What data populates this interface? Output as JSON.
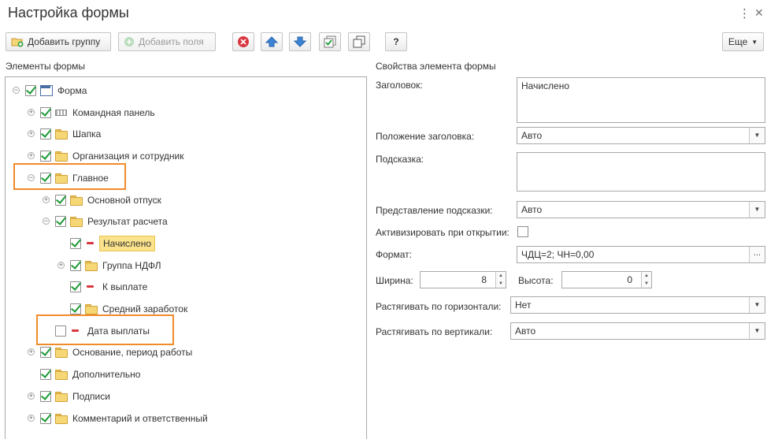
{
  "window": {
    "title": "Настройка формы"
  },
  "toolbar": {
    "add_group_label": "Добавить группу",
    "add_fields_label": "Добавить поля",
    "help_label": "?",
    "more_label": "Еще"
  },
  "colors": {
    "accent_highlight": "#f08b2a",
    "selection": "#fbe38b",
    "check": "#1d9b37"
  },
  "left": {
    "title": "Элементы формы",
    "tree": [
      {
        "label": "Форма",
        "level": 0,
        "expander": "minus",
        "checked": true,
        "icon": "form-icon"
      },
      {
        "label": "Командная панель",
        "level": 1,
        "expander": "plus",
        "checked": true,
        "icon": "command-panel-icon"
      },
      {
        "label": "Шапка",
        "level": 1,
        "expander": "plus",
        "checked": true,
        "icon": "folder-icon"
      },
      {
        "label": "Организация и сотрудник",
        "level": 1,
        "expander": "plus",
        "checked": true,
        "icon": "folder-icon"
      },
      {
        "label": "Главное",
        "level": 1,
        "expander": "minus",
        "checked": true,
        "icon": "folder-icon"
      },
      {
        "label": "Основной отпуск",
        "level": 2,
        "expander": "plus",
        "checked": true,
        "icon": "folder-icon"
      },
      {
        "label": "Результат расчета",
        "level": 2,
        "expander": "minus",
        "checked": true,
        "icon": "folder-icon"
      },
      {
        "label": "Начислено",
        "level": 3,
        "expander": "",
        "checked": true,
        "icon": "field-icon",
        "selected": true
      },
      {
        "label": "Группа НДФЛ",
        "level": 3,
        "expander": "plus",
        "checked": true,
        "icon": "folder-icon"
      },
      {
        "label": "К выплате",
        "level": 3,
        "expander": "",
        "checked": true,
        "icon": "field-icon"
      },
      {
        "label": "Средний заработок",
        "level": 3,
        "expander": "",
        "checked": true,
        "icon": "folder-icon"
      },
      {
        "label": "Дата выплаты",
        "level": 2,
        "expander": "",
        "checked": false,
        "icon": "field-icon"
      },
      {
        "label": "Основание, период работы",
        "level": 1,
        "expander": "plus",
        "checked": true,
        "icon": "folder-icon"
      },
      {
        "label": "Дополнительно",
        "level": 1,
        "expander": "",
        "checked": true,
        "icon": "folder-icon"
      },
      {
        "label": "Подписи",
        "level": 1,
        "expander": "plus",
        "checked": true,
        "icon": "folder-icon"
      },
      {
        "label": "Комментарий и ответственный",
        "level": 1,
        "expander": "plus",
        "checked": true,
        "icon": "folder-icon"
      }
    ]
  },
  "right": {
    "title": "Свойства элемента формы",
    "header_label": "Заголовок:",
    "header_value": "Начислено",
    "title_position_label": "Положение заголовка:",
    "title_position_value": "Авто",
    "tooltip_label": "Подсказка:",
    "tooltip_value": "",
    "tooltip_repr_label": "Представление подсказки:",
    "tooltip_repr_value": "Авто",
    "activate_label": "Активизировать при открытии:",
    "format_label": "Формат:",
    "format_value": "ЧДЦ=2; ЧН=0,00",
    "format_button": "...",
    "width_label": "Ширина:",
    "width_value": "8",
    "height_label": "Высота:",
    "height_value": "0",
    "stretch_h_label": "Растягивать по горизонтали:",
    "stretch_h_value": "Нет",
    "stretch_v_label": "Растягивать по вертикали:",
    "stretch_v_value": "Авто"
  }
}
